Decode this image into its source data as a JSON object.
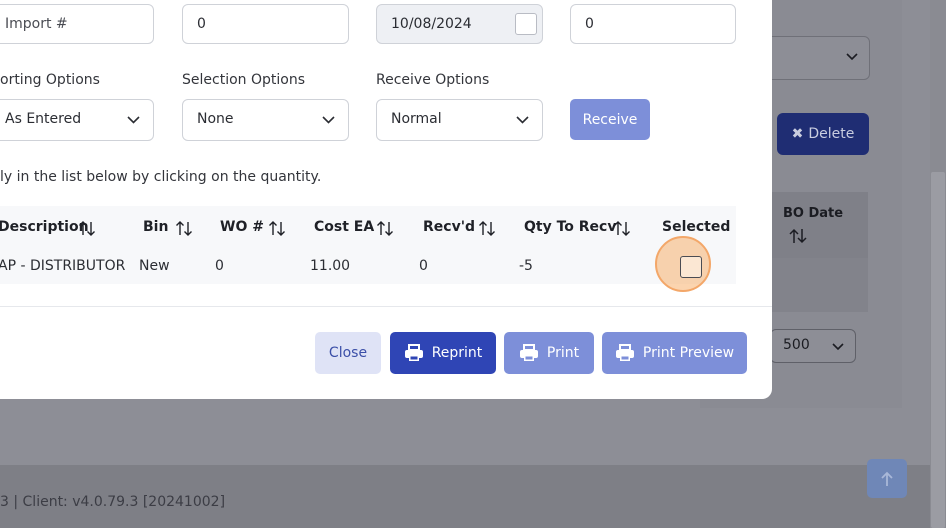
{
  "background": {
    "delete_label": "Delete",
    "bo_date_header": "BO Date",
    "page_size": "500",
    "footer_text": "3 | Client: v4.0.79.3 [20241002]"
  },
  "form": {
    "import_placeholder": "Import #",
    "field2_value": "0",
    "date_value": "10/08/2024",
    "field4_value": "0",
    "sorting_label": "orting Options",
    "sorting_value": "As Entered",
    "selection_label": "Selection Options",
    "selection_value": "None",
    "receive_label": "Receive Options",
    "receive_value": "Normal",
    "receive_button": "Receive",
    "help_text": "ly in the list below by clicking on the quantity."
  },
  "table": {
    "headers": [
      "Description",
      "Bin",
      "WO #",
      "Cost EA",
      "Recv'd",
      "Qty To Recv",
      "Selected"
    ],
    "rows": [
      [
        "AP - DISTRIBUTOR",
        "New",
        "0",
        "11.00",
        "0",
        "-5"
      ]
    ]
  },
  "footer_buttons": {
    "close": "Close",
    "reprint": "Reprint",
    "print": "Print",
    "print_preview": "Print Preview"
  },
  "colors": {
    "primary": "#2f45b5",
    "primary_light": "#7d8fd9",
    "highlight": "#f3a769"
  }
}
